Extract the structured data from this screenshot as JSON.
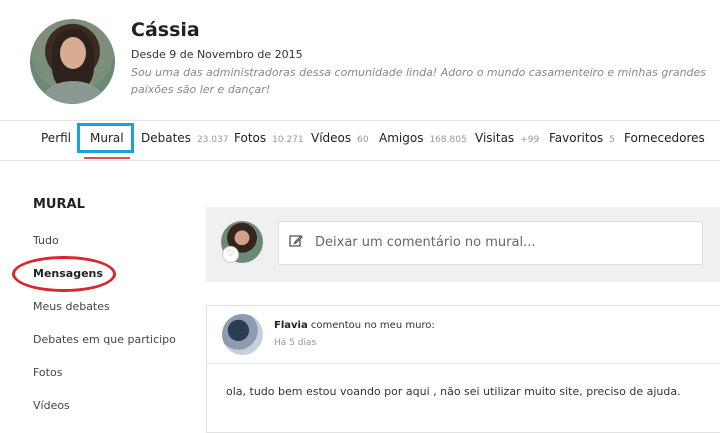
{
  "profile": {
    "name": "Cássia",
    "since": "Desde 9 de Novembro de 2015",
    "bio": "Sou uma das administradoras dessa comunidade linda! Adoro o mundo casamenteiro e minhas grandes paixões são ler e dançar!"
  },
  "nav": [
    {
      "label": "Perfil",
      "count": ""
    },
    {
      "label": "Mural",
      "count": ""
    },
    {
      "label": "Debates",
      "count": "23.037"
    },
    {
      "label": "Fotos",
      "count": "10.271"
    },
    {
      "label": "Vídeos",
      "count": "60"
    },
    {
      "label": "Amigos",
      "count": "168.805"
    },
    {
      "label": "Visitas",
      "count": "+99"
    },
    {
      "label": "Favoritos",
      "count": "5"
    },
    {
      "label": "Fornecedores",
      "count": ""
    }
  ],
  "sidebar": {
    "title": "MURAL",
    "items": [
      "Tudo",
      "Mensagens",
      "Meus debates",
      "Debates em que participo",
      "Fotos",
      "Vídeos"
    ]
  },
  "comment_box": {
    "placeholder": "Deixar um comentário no mural..."
  },
  "post": {
    "author": "Flavia",
    "action": "comentou no meu muro:",
    "time": "Há 5 dias",
    "text": "ola, tudo bem estou voando por aqui , não sei utilizar muito site, preciso de ajuda."
  },
  "colors": {
    "highlight_box": "#1aa1de",
    "active_underline": "#e04f4f",
    "annotation_oval": "#d8282c"
  }
}
